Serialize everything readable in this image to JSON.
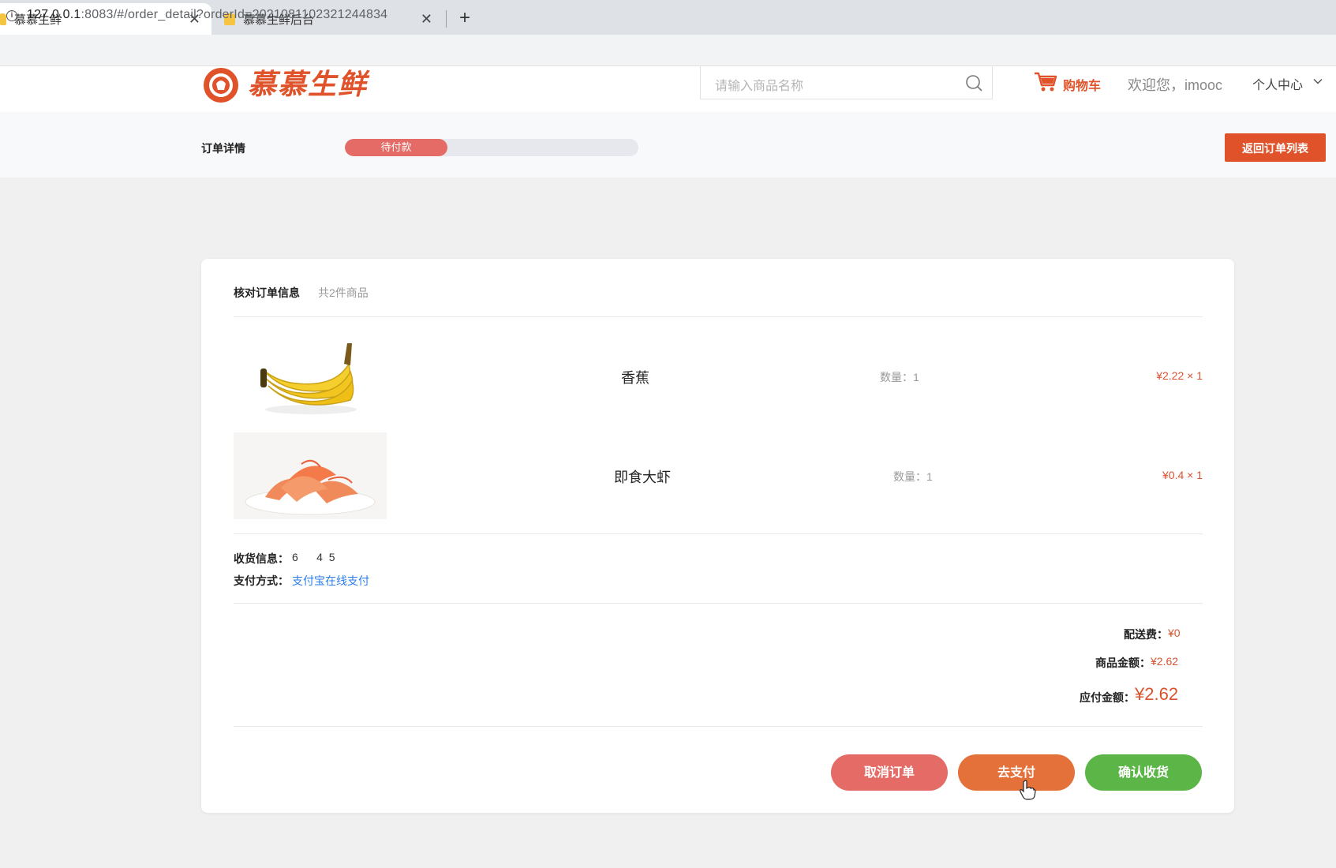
{
  "browser": {
    "tabs": [
      {
        "title": "慕慕生鲜",
        "active": true
      },
      {
        "title": "慕慕生鲜后台",
        "active": false
      }
    ],
    "close_glyph": "✕",
    "new_tab_glyph": "+",
    "url_host": "127.0.0.1",
    "url_rest": ":8083/#/order_detail?orderId=20210811023212448​34"
  },
  "header": {
    "logo_text": "慕慕生鲜",
    "search_placeholder": "请输入商品名称",
    "cart_label": "购物车",
    "welcome": "欢迎您，imooc",
    "personal_center": "个人中心"
  },
  "status_bar": {
    "title": "订单详情",
    "progress_label": "待付款",
    "progress_fraction": 0.35,
    "back_button": "返回订单列表"
  },
  "order": {
    "title": "核对订单信息",
    "count_text": "共2件商品",
    "items": [
      {
        "name": "香蕉",
        "qty": "数量：1",
        "price": "¥2.22 × 1",
        "image": "banana"
      },
      {
        "name": "即食大虾",
        "qty": "数量：1",
        "price": "¥0.4 × 1",
        "image": "shrimp"
      }
    ],
    "shipping_label": "收货信息：",
    "shipping_value": "6      4  5",
    "payment_label": "支付方式：",
    "payment_value": "支付宝在线支付"
  },
  "summary": {
    "delivery_label": "配送费：",
    "delivery_value": "¥0",
    "goods_label": "商品金额：",
    "goods_value": "¥2.62",
    "total_label": "应付金额：",
    "total_value": "¥2.62"
  },
  "actions": {
    "cancel": "取消订单",
    "pay": "去支付",
    "confirm": "确认收货"
  },
  "colors": {
    "brand": "#e0522a",
    "price": "#d9532f",
    "cancel": "#e56b66",
    "pay": "#e4703a",
    "confirm": "#5bb547",
    "link": "#2b7de9"
  }
}
